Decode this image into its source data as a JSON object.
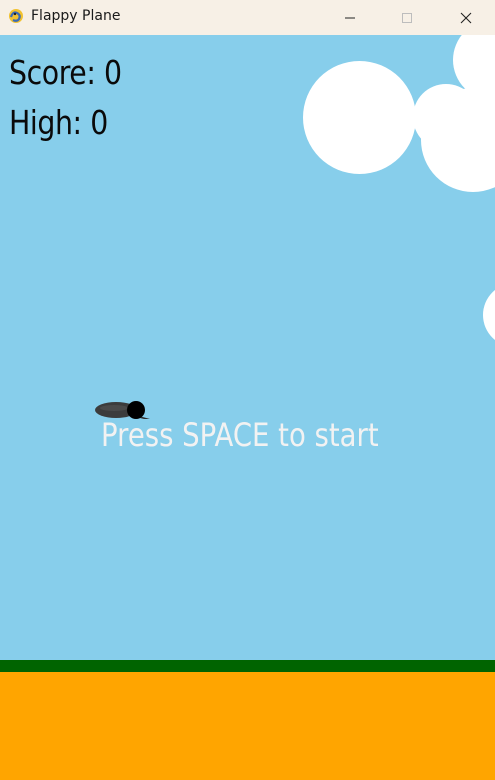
{
  "window": {
    "title": "Flappy Plane",
    "minimize_icon": "minimize-icon",
    "maximize_icon": "maximize-icon",
    "close_icon": "close-icon",
    "app_icon": "pygame-snake-icon"
  },
  "hud": {
    "score_text": "Score: 0",
    "high_text": "High: 0"
  },
  "message": {
    "start_text": "Press SPACE to start"
  },
  "colors": {
    "sky": "#87CEEB",
    "grass": "#006400",
    "ground": "#FFA500",
    "cloud": "#FFFFFF",
    "message": "#F2F2F2",
    "plane": "#3a3a3a"
  }
}
